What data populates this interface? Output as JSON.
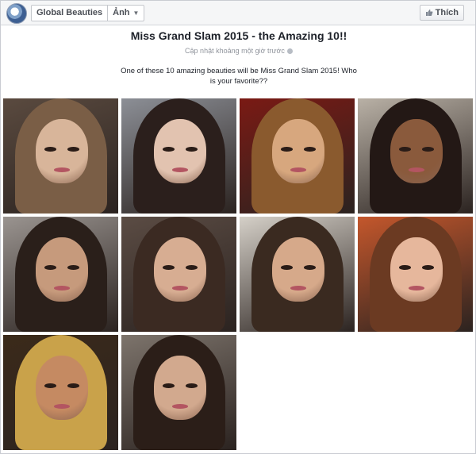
{
  "header": {
    "page_name": "Global Beauties",
    "section": "Ảnh",
    "like_label": "Thích"
  },
  "album": {
    "title": "Miss Grand Slam 2015 - the Amazing 10!!",
    "updated": "Cập nhật khoảng một giờ trước",
    "description": "One of these 10 amazing beauties will be Miss Grand Slam 2015! Who is your favorite??"
  },
  "photos": [
    {
      "bg": "#5a4a3f",
      "hair": "#7a5e46",
      "skin": "#d8b59a"
    },
    {
      "bg": "#8c8f96",
      "hair": "#2b1f1c",
      "skin": "#e2c3b0"
    },
    {
      "bg": "#7a1a14",
      "hair": "#8a5a2e",
      "skin": "#d7a77e"
    },
    {
      "bg": "#b9b1a6",
      "hair": "#231815",
      "skin": "#8a5a3c"
    },
    {
      "bg": "#9a9490",
      "hair": "#2a1f1a",
      "skin": "#c69a7c"
    },
    {
      "bg": "#5b4c44",
      "hair": "#3b2a22",
      "skin": "#d7ad92"
    },
    {
      "bg": "#d5d0c8",
      "hair": "#3a2a20",
      "skin": "#d6a98a"
    },
    {
      "bg": "#c4572c",
      "hair": "#6b3a22",
      "skin": "#e6b79c"
    },
    {
      "bg": "#3b2a1a",
      "hair": "#c9a24a",
      "skin": "#c58a62"
    },
    {
      "bg": "#7d746c",
      "hair": "#2b1e18",
      "skin": "#d2a98e"
    }
  ]
}
